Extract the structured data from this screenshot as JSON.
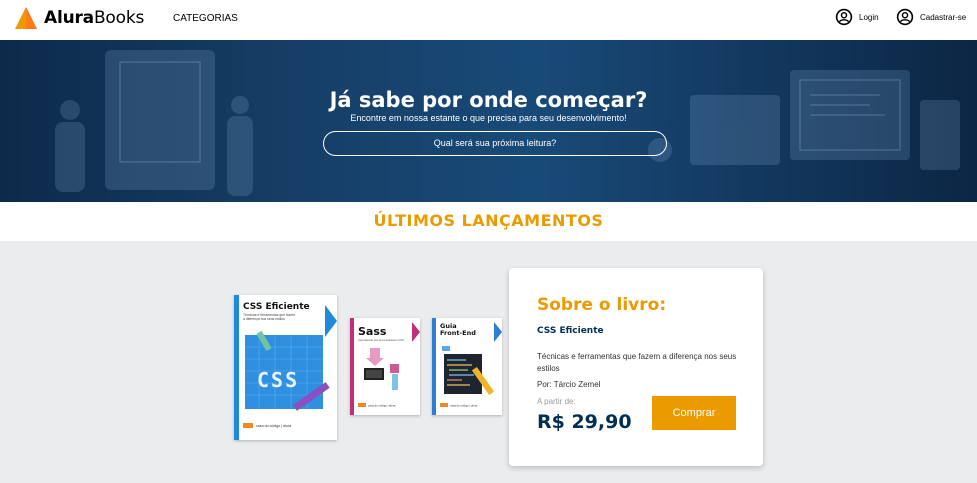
{
  "header": {
    "logo": {
      "brand_bold": "Alura",
      "brand_rest": "Books"
    },
    "nav": {
      "categories": "CATEGORIAS"
    },
    "user": {
      "login": "Login",
      "signup": "Cadastrar-se"
    }
  },
  "banner": {
    "title": "Já sabe por onde começar?",
    "subtitle": "Encontre em nossa estante o que precisa para seu desenvolvimento!",
    "search_placeholder": "Qual será sua próxima leitura?"
  },
  "section": {
    "title": "ÚLTIMOS LANÇAMENTOS"
  },
  "books": [
    {
      "title": "CSS Eficiente",
      "subtitle": "Técnicas e ferramentas que fazem a diferença nos seus estilos",
      "cover_word": "CSS",
      "publisher": "casa do código | alura",
      "accent": "#1f8ad8"
    },
    {
      "title": "Sass",
      "subtitle": "Aprendendo pré-processadores CSS",
      "publisher": "casa do código | alura",
      "accent": "#c0307a"
    },
    {
      "title_line1": "Guia",
      "title_line2": "Front-End",
      "publisher": "casa do código | alura",
      "accent": "#2f7fd0"
    }
  ],
  "detail": {
    "heading": "Sobre o livro:",
    "book_title": "CSS Eficiente",
    "description": "Técnicas e ferramentas que fazem a diferença nos seus estilos",
    "author": "Por: Tárcio Zemel",
    "price_label": "A partir de:",
    "price": "R$ 29,90",
    "buy_label": "Comprar"
  },
  "colors": {
    "accent": "#eb9b00",
    "navy": "#002f52",
    "banner": "#184a78",
    "showcase_bg": "#ebecee"
  },
  "icons": {
    "logo": "alurabooks-triangle-icon",
    "user": "user-circle-icon"
  }
}
